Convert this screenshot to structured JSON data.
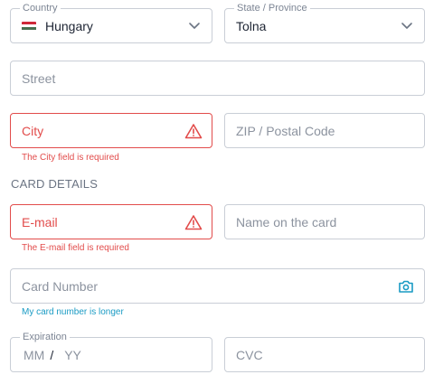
{
  "address": {
    "country": {
      "label": "Country",
      "value": "Hungary",
      "flag_colors": [
        "#CE2939",
        "#FFFFFF",
        "#477050"
      ]
    },
    "state": {
      "label": "State / Province",
      "value": "Tolna"
    },
    "street": {
      "placeholder": "Street"
    },
    "city": {
      "placeholder": "City",
      "error": "The City field is required"
    },
    "zip": {
      "placeholder": "ZIP / Postal Code"
    }
  },
  "card": {
    "section_title": "CARD DETAILS",
    "email": {
      "placeholder": "E-mail",
      "error": "The E-mail field is required"
    },
    "name_on_card": {
      "placeholder": "Name on the card"
    },
    "card_number": {
      "placeholder": "Card Number",
      "helper": "My card number is longer"
    },
    "expiration": {
      "label": "Expiration",
      "month_placeholder": "MM",
      "separator": "/",
      "year_placeholder": "YY"
    },
    "cvc": {
      "placeholder": "CVC"
    }
  },
  "colors": {
    "error": "#e24c4b",
    "info": "#1a9bc4",
    "border": "#c9ced6"
  }
}
